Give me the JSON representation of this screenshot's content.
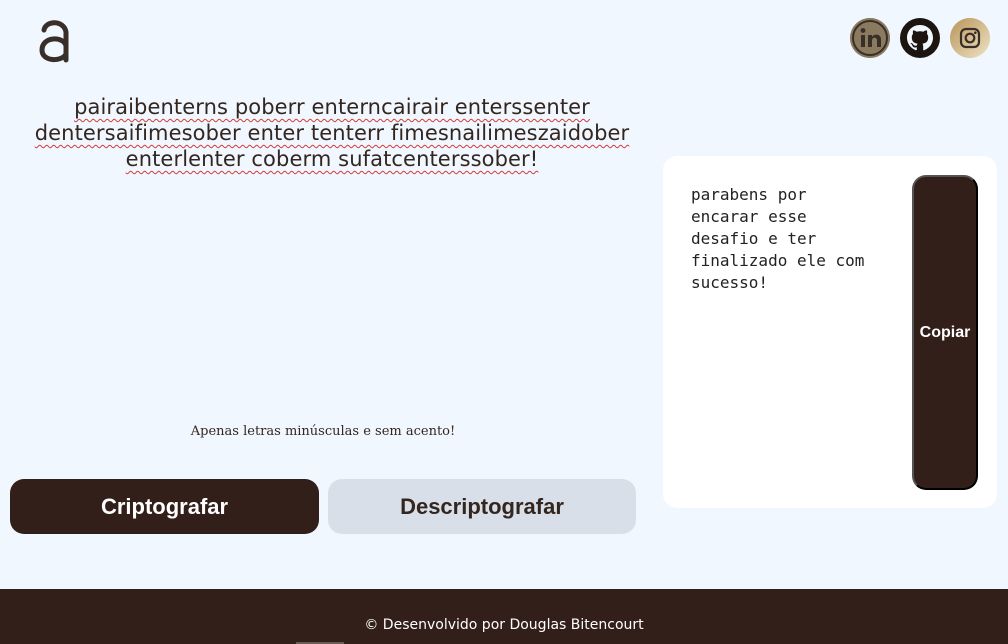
{
  "header": {
    "logo_icon": "alura-a-logo-icon",
    "social": [
      {
        "name": "linkedin",
        "icon": "linkedin-icon"
      },
      {
        "name": "github",
        "icon": "github-icon"
      },
      {
        "name": "instagram",
        "icon": "instagram-icon"
      }
    ]
  },
  "input": {
    "value": "pairaibenterns poberr enterncairair enterssenter dentersaifimesober enter tenterr fimesnailimeszaidober enterlenter coberm sufatcenterssober!"
  },
  "hint": "Apenas letras minúsculas e sem acento!",
  "buttons": {
    "encrypt": "Criptografar",
    "decrypt": "Descriptografar",
    "copy": "Copiar"
  },
  "output": {
    "text": "parabens por\nencarar esse\ndesafio e ter\nfinalizado ele com\nsucesso!"
  },
  "footer": {
    "text": "© Desenvolvido por Douglas Bitencourt"
  },
  "colors": {
    "background": "#f0f7ff",
    "primary": "#331f19",
    "secondary_button": "#d8dfe8",
    "card": "#ffffff"
  }
}
